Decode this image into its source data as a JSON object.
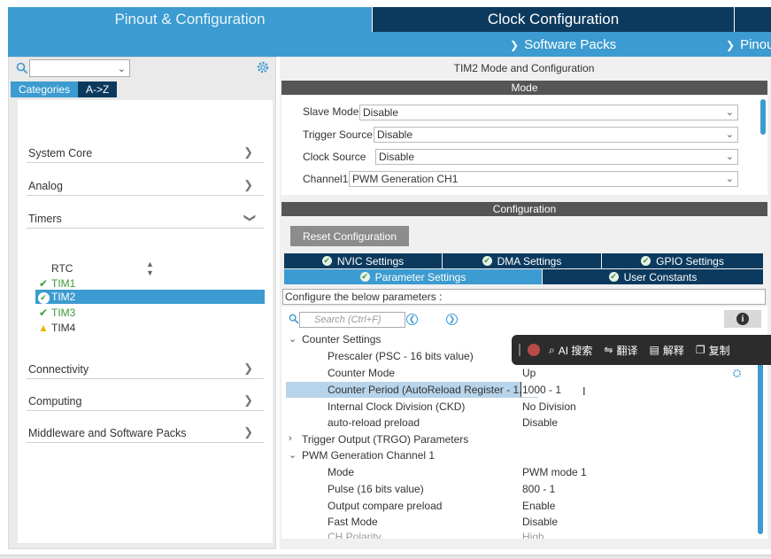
{
  "top_tabs": {
    "pinout": "Pinout & Configuration",
    "clock": "Clock Configuration"
  },
  "sub_menu": {
    "software_packs": "Software Packs",
    "pinout": "Pinou"
  },
  "left": {
    "tabs": [
      "Categories",
      "A->Z"
    ],
    "categories": {
      "system_core": "System Core",
      "analog": "Analog",
      "timers": "Timers",
      "connectivity": "Connectivity",
      "computing": "Computing",
      "middleware": "Middleware and Software Packs"
    },
    "timers": [
      "RTC",
      "TIM1",
      "TIM2",
      "TIM3",
      "TIM4"
    ]
  },
  "right": {
    "title": "TIM2 Mode and Configuration",
    "mode_header": "Mode",
    "mode_rows": [
      {
        "label": "Slave Mode",
        "value": "Disable"
      },
      {
        "label": "Trigger Source",
        "value": "Disable"
      },
      {
        "label": "Clock Source",
        "value": "Disable"
      },
      {
        "label": "Channel1",
        "value": "PWM Generation CH1"
      }
    ],
    "config_header": "Configuration",
    "reset_button": "Reset Configuration",
    "tabs": {
      "nvic": "NVIC Settings",
      "dma": "DMA Settings",
      "gpio": "GPIO Settings",
      "parameter": "Parameter Settings",
      "user_constants": "User Constants"
    },
    "configure_label": "Configure the below parameters :",
    "search_placeholder": "Search (Ctrl+F)",
    "params": {
      "counter_settings": "Counter Settings",
      "prescaler": "Prescaler (PSC - 16 bits value)",
      "counter_mode": "Counter Mode",
      "counter_mode_val": "Up",
      "counter_period": "Counter Period (AutoReload Register - 1...",
      "counter_period_val": "1000",
      "counter_period_suffix": "- 1",
      "ckd": "Internal Clock Division (CKD)",
      "ckd_val": "No Division",
      "arp": "auto-reload preload",
      "arp_val": "Disable",
      "trgo": "Trigger Output (TRGO) Parameters",
      "pwm_ch1": "PWM Generation Channel 1",
      "mode": "Mode",
      "mode_val": "PWM mode 1",
      "pulse": "Pulse (16 bits value)",
      "pulse_val": "800 - 1",
      "ocp": "Output compare preload",
      "ocp_val": "Enable",
      "fast": "Fast Mode",
      "fast_val": "Disable",
      "ch_pol": "CH Polarity",
      "ch_pol_val": "High"
    }
  },
  "float_toolbar": {
    "ai_search": "AI 搜索",
    "translate": "翻译",
    "explain": "解释",
    "copy": "复制"
  },
  "colors": {
    "accent": "#3c9bd0",
    "dark": "#0c3a5e",
    "ok_green": "#3a9a3a",
    "warn_yellow": "#e6b800"
  }
}
